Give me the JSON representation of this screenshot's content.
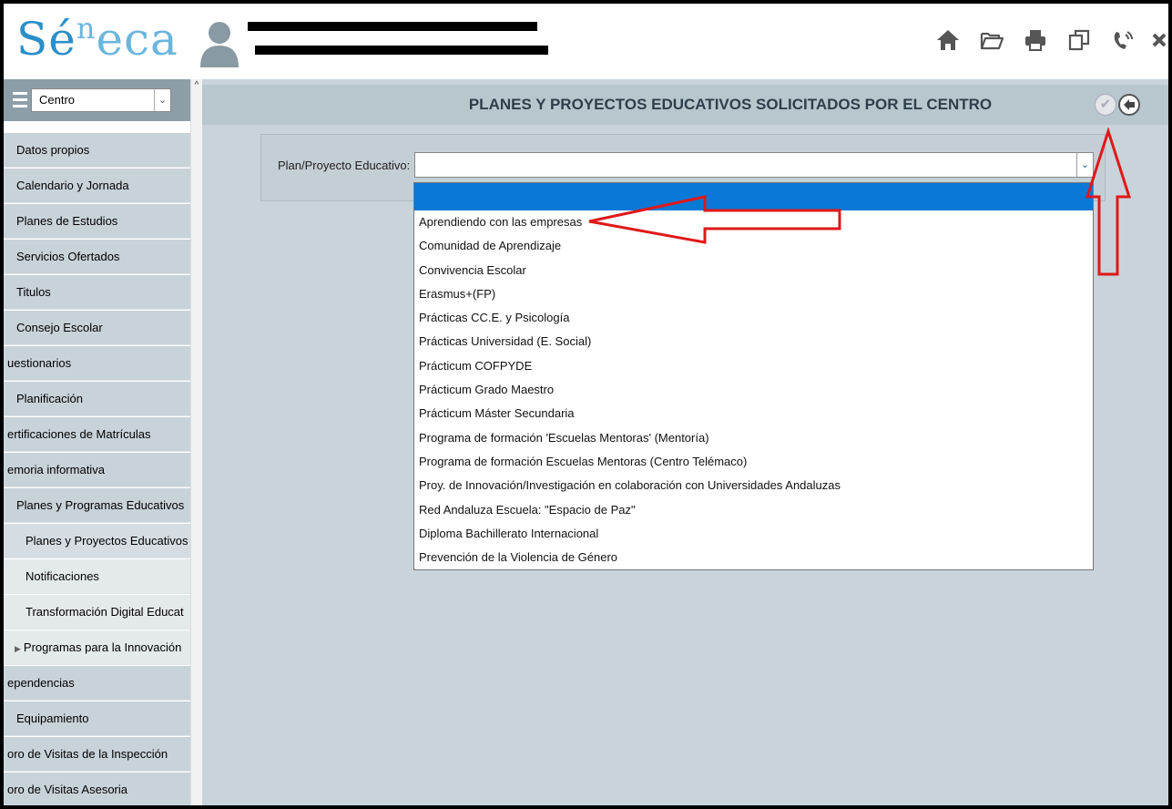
{
  "header": {
    "logo_main": "Sé",
    "logo_sup": "n",
    "logo_tail": "eca",
    "icons": [
      "home-icon",
      "folder-open-icon",
      "print-icon",
      "copy-icon",
      "phone-icon",
      "close-icon"
    ]
  },
  "sidebar": {
    "select_value": "Centro",
    "items": [
      {
        "label": "Datos propios"
      },
      {
        "label": "Calendario y Jornada"
      },
      {
        "label": "Planes de Estudios"
      },
      {
        "label": "Servicios Ofertados"
      },
      {
        "label": "Titulos"
      },
      {
        "label": "Consejo Escolar"
      },
      {
        "label": "uestionarios"
      },
      {
        "label": "Planificación"
      },
      {
        "label": "ertificaciones de Matrículas"
      },
      {
        "label": "emoria informativa"
      },
      {
        "label": "Planes y Programas Educativos"
      },
      {
        "label": "Planes y Proyectos Educativos"
      },
      {
        "label": "Notificaciones"
      },
      {
        "label": "Transformación Digital Educat"
      },
      {
        "label": "Programas para la Innovación"
      },
      {
        "label": "ependencias"
      },
      {
        "label": "Equipamiento"
      },
      {
        "label": "oro de Visitas de la Inspección"
      },
      {
        "label": "oro de Visitas Asesoria"
      }
    ]
  },
  "main": {
    "title": "PLANES Y PROYECTOS EDUCATIVOS SOLICITADOS POR EL CENTRO",
    "field_label": "Plan/Proyecto Educativo:",
    "select_value": "",
    "options": [
      "Aprendiendo con las empresas",
      "Comunidad de Aprendizaje",
      "Convivencia Escolar",
      "Erasmus+(FP)",
      "Prácticas CC.E. y Psicología",
      "Prácticas Universidad (E. Social)",
      "Prácticum COFPYDE",
      "Prácticum Grado Maestro",
      "Prácticum Máster Secundaria",
      "Programa de formación 'Escuelas Mentoras' (Mentoría)",
      "Programa de formación Escuelas Mentoras (Centro Telémaco)",
      "Proy. de Innovación/Investigación en colaboración con Universidades Andaluzas",
      "Red Andaluza Escuela: \"Espacio de Paz\"",
      "Diploma Bachillerato Internacional",
      "Prevención de la Violencia de Género"
    ]
  },
  "colors": {
    "accent": "#0a78d6",
    "annotation": "#e01818",
    "logo": "#2b8fc8"
  }
}
